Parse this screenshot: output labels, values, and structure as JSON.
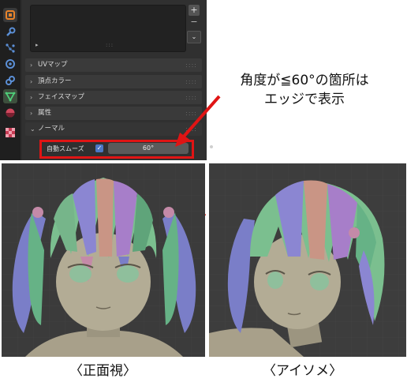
{
  "panel": {
    "tabs": [
      {
        "icon": "modifier-icon"
      },
      {
        "icon": "wrench-icon"
      },
      {
        "icon": "particles-icon"
      },
      {
        "icon": "physics-icon"
      },
      {
        "icon": "constraints-icon"
      },
      {
        "icon": "mesh-data-icon",
        "active": true
      },
      {
        "icon": "material-icon"
      },
      {
        "icon": "texture-icon"
      }
    ],
    "list_controls": {
      "add": "+",
      "remove": "−",
      "dropdown": "⌄"
    },
    "list_play": "▸",
    "list_grip": ":::",
    "sections": [
      {
        "label": "UVマップ",
        "expanded": false
      },
      {
        "label": "頂点カラー",
        "expanded": false
      },
      {
        "label": "フェイスマップ",
        "expanded": false
      },
      {
        "label": "属性",
        "expanded": false
      },
      {
        "label": "ノーマル",
        "expanded": true
      }
    ],
    "normal": {
      "auto_smooth_label": "自動スムーズ",
      "auto_smooth_checked": true,
      "angle_value": "60°"
    }
  },
  "annotation": {
    "line1": "角度が≦60°の箇所は",
    "line2": "エッジで表示",
    "color": "#e01414"
  },
  "captions": {
    "front": "〈正面視〉",
    "iso": "〈アイソメ〉"
  },
  "colors": {
    "highlight": "#e01414",
    "panel_bg": "#303030",
    "checkbox": "#4b76c4"
  }
}
